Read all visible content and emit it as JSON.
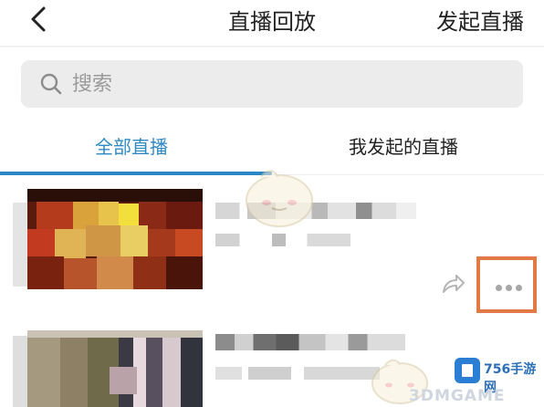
{
  "header": {
    "title": "直播回放",
    "action_label": "发起直播"
  },
  "search": {
    "placeholder": "搜索"
  },
  "tabs": [
    {
      "label": "全部直播",
      "active": true
    },
    {
      "label": "我发起的直播",
      "active": false
    }
  ],
  "list_items": [
    {
      "actions": [
        "share",
        "more"
      ]
    },
    {
      "actions": []
    }
  ],
  "watermark": {
    "brand": "756手游网",
    "sub": "3DMGAME"
  },
  "colors": {
    "accent": "#2f8ac4",
    "highlight_box": "#e17a45",
    "search_bg": "#ececec"
  },
  "icons": {
    "back": "chevron-left-icon",
    "search": "search-icon",
    "share": "share-icon",
    "more": "more-dots-icon"
  }
}
